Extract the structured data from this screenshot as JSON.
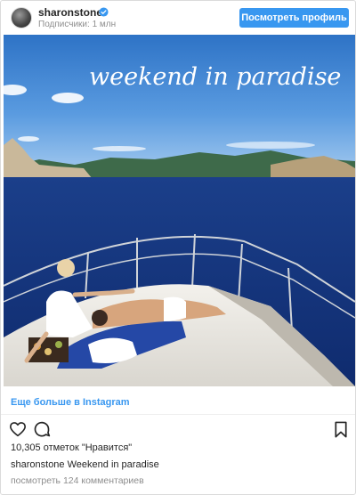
{
  "header": {
    "username": "sharonstone",
    "followers": "Подписчики: 1 млн",
    "view_profile": "Посмотреть профиль"
  },
  "photo": {
    "overlay_text": "weekend in paradise"
  },
  "more_link": "Еще больше в Instagram",
  "likes": "10,305 отметок \"Нравится\"",
  "caption": {
    "username": "sharonstone",
    "text": "Weekend in paradise"
  },
  "comments_link": "посмотреть 124 комментариев",
  "icons": [
    "verified-badge-icon",
    "heart-icon",
    "comment-icon",
    "bookmark-icon"
  ],
  "colors": {
    "accent": "#3897f0",
    "muted": "#8e8e8e",
    "text": "#262626"
  }
}
